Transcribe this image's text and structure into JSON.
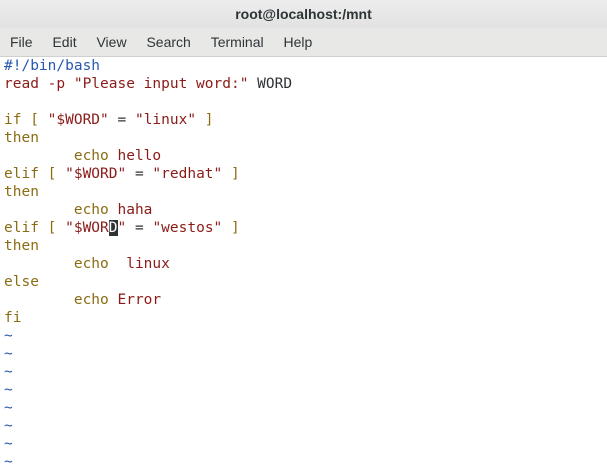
{
  "window": {
    "title": "root@localhost:/mnt"
  },
  "menu": [
    "File",
    "Edit",
    "View",
    "Search",
    "Terminal",
    "Help"
  ],
  "code": {
    "l1": "#!/bin/bash",
    "l2a": "read -p",
    "l2b": " \"Please input word:\"",
    "l2c": " WORD",
    "l3": "",
    "l4a": "if [ ",
    "l4b": "\"$WORD\"",
    "l4c": " = ",
    "l4d": "\"linux\"",
    "l4e": " ]",
    "l5": "then",
    "l6a": "        echo",
    "l6b": " hello",
    "l7a": "elif [ ",
    "l7b": "\"$WORD\"",
    "l7c": " = ",
    "l7d": "\"redhat\"",
    "l7e": " ]",
    "l8": "then",
    "l9a": "        echo",
    "l9b": " haha",
    "l10a": "elif [ ",
    "l10b1": "\"$WOR",
    "l10cursor": "D",
    "l10b2": "\"",
    "l10c": " = ",
    "l10d": "\"westos\"",
    "l10e": " ]",
    "l11": "then",
    "l12a": "        echo",
    "l12b": "  linux",
    "l13": "else",
    "l14a": "        echo",
    "l14b": " Error",
    "l15": "fi",
    "tilde": "~"
  }
}
